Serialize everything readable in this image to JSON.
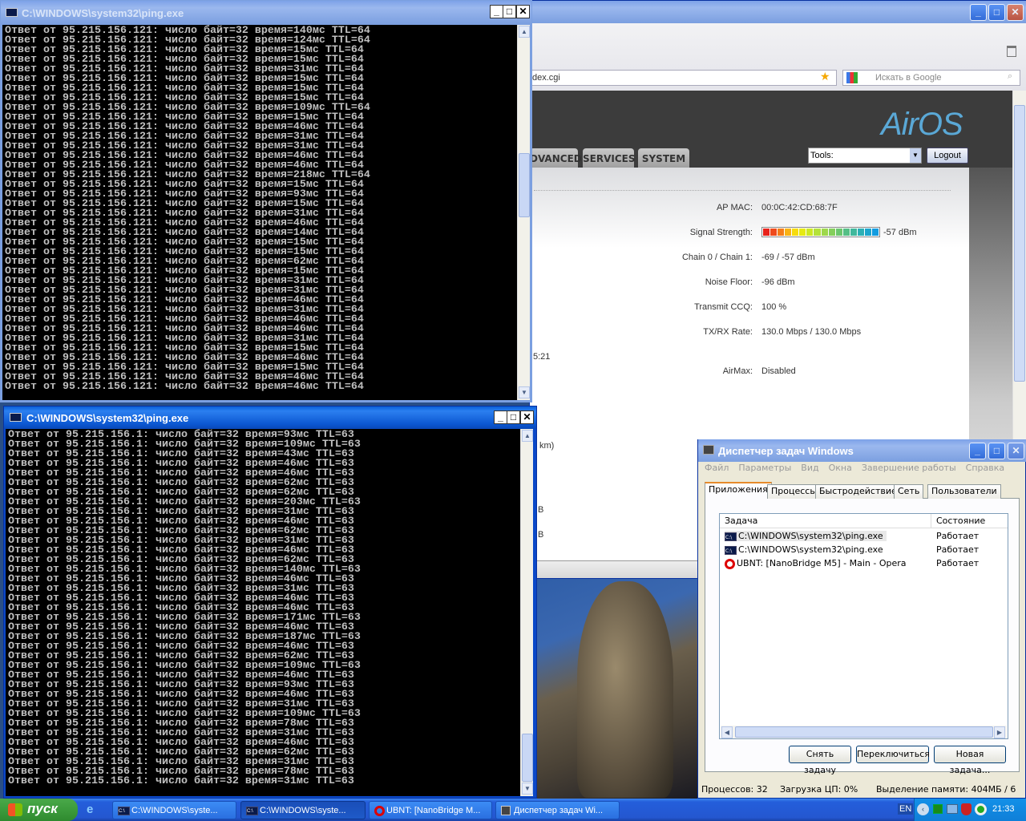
{
  "ping_top": {
    "title": "C:\\WINDOWS\\system32\\ping.exe",
    "lines": [
      "Ответ от 95.215.156.121: число байт=32 время=140мс TTL=64",
      "Ответ от 95.215.156.121: число байт=32 время=124мс TTL=64",
      "Ответ от 95.215.156.121: число байт=32 время=15мс TTL=64",
      "Ответ от 95.215.156.121: число байт=32 время=15мс TTL=64",
      "Ответ от 95.215.156.121: число байт=32 время=31мс TTL=64",
      "Ответ от 95.215.156.121: число байт=32 время=15мс TTL=64",
      "Ответ от 95.215.156.121: число байт=32 время=15мс TTL=64",
      "Ответ от 95.215.156.121: число байт=32 время=15мс TTL=64",
      "Ответ от 95.215.156.121: число байт=32 время=109мс TTL=64",
      "Ответ от 95.215.156.121: число байт=32 время=15мс TTL=64",
      "Ответ от 95.215.156.121: число байт=32 время=46мс TTL=64",
      "Ответ от 95.215.156.121: число байт=32 время=31мс TTL=64",
      "Ответ от 95.215.156.121: число байт=32 время=31мс TTL=64",
      "Ответ от 95.215.156.121: число байт=32 время=46мс TTL=64",
      "Ответ от 95.215.156.121: число байт=32 время=46мс TTL=64",
      "Ответ от 95.215.156.121: число байт=32 время=218мс TTL=64",
      "Ответ от 95.215.156.121: число байт=32 время=15мс TTL=64",
      "Ответ от 95.215.156.121: число байт=32 время=93мс TTL=64",
      "Ответ от 95.215.156.121: число байт=32 время=15мс TTL=64",
      "Ответ от 95.215.156.121: число байт=32 время=31мс TTL=64",
      "Ответ от 95.215.156.121: число байт=32 время=46мс TTL=64",
      "Ответ от 95.215.156.121: число байт=32 время=14мс TTL=64",
      "Ответ от 95.215.156.121: число байт=32 время=15мс TTL=64",
      "Ответ от 95.215.156.121: число байт=32 время=15мс TTL=64",
      "Ответ от 95.215.156.121: число байт=32 время=62мс TTL=64",
      "Ответ от 95.215.156.121: число байт=32 время=15мс TTL=64",
      "Ответ от 95.215.156.121: число байт=32 время=31мс TTL=64",
      "Ответ от 95.215.156.121: число байт=32 время=31мс TTL=64",
      "Ответ от 95.215.156.121: число байт=32 время=46мс TTL=64",
      "Ответ от 95.215.156.121: число байт=32 время=31мс TTL=64",
      "Ответ от 95.215.156.121: число байт=32 время=46мс TTL=64",
      "Ответ от 95.215.156.121: число байт=32 время=46мс TTL=64",
      "Ответ от 95.215.156.121: число байт=32 время=31мс TTL=64",
      "Ответ от 95.215.156.121: число байт=32 время=15мс TTL=64",
      "Ответ от 95.215.156.121: число байт=32 время=46мс TTL=64",
      "Ответ от 95.215.156.121: число байт=32 время=15мс TTL=64",
      "Ответ от 95.215.156.121: число байт=32 время=46мс TTL=64",
      "Ответ от 95.215.156.121: число байт=32 время=46мс TTL=64"
    ]
  },
  "ping_bottom": {
    "title": "C:\\WINDOWS\\system32\\ping.exe",
    "lines": [
      "Ответ от 95.215.156.1: число байт=32 время=93мс TTL=63",
      "Ответ от 95.215.156.1: число байт=32 время=109мс TTL=63",
      "Ответ от 95.215.156.1: число байт=32 время=43мс TTL=63",
      "Ответ от 95.215.156.1: число байт=32 время=46мс TTL=63",
      "Ответ от 95.215.156.1: число байт=32 время=46мс TTL=63",
      "Ответ от 95.215.156.1: число байт=32 время=62мс TTL=63",
      "Ответ от 95.215.156.1: число байт=32 время=62мс TTL=63",
      "Ответ от 95.215.156.1: число байт=32 время=203мс TTL=63",
      "Ответ от 95.215.156.1: число байт=32 время=31мс TTL=63",
      "Ответ от 95.215.156.1: число байт=32 время=46мс TTL=63",
      "Ответ от 95.215.156.1: число байт=32 время=62мс TTL=63",
      "Ответ от 95.215.156.1: число байт=32 время=31мс TTL=63",
      "Ответ от 95.215.156.1: число байт=32 время=46мс TTL=63",
      "Ответ от 95.215.156.1: число байт=32 время=62мс TTL=63",
      "Ответ от 95.215.156.1: число байт=32 время=140мс TTL=63",
      "Ответ от 95.215.156.1: число байт=32 время=46мс TTL=63",
      "Ответ от 95.215.156.1: число байт=32 время=31мс TTL=63",
      "Ответ от 95.215.156.1: число байт=32 время=46мс TTL=63",
      "Ответ от 95.215.156.1: число байт=32 время=46мс TTL=63",
      "Ответ от 95.215.156.1: число байт=32 время=171мс TTL=63",
      "Ответ от 95.215.156.1: число байт=32 время=46мс TTL=63",
      "Ответ от 95.215.156.1: число байт=32 время=187мс TTL=63",
      "Ответ от 95.215.156.1: число байт=32 время=46мс TTL=63",
      "Ответ от 95.215.156.1: число байт=32 время=62мс TTL=63",
      "Ответ от 95.215.156.1: число байт=32 время=109мс TTL=63",
      "Ответ от 95.215.156.1: число байт=32 время=46мс TTL=63",
      "Ответ от 95.215.156.1: число байт=32 время=93мс TTL=63",
      "Ответ от 95.215.156.1: число байт=32 время=46мс TTL=63",
      "Ответ от 95.215.156.1: число байт=32 время=31мс TTL=63",
      "Ответ от 95.215.156.1: число байт=32 время=109мс TTL=63",
      "Ответ от 95.215.156.1: число байт=32 время=78мс TTL=63",
      "Ответ от 95.215.156.1: число байт=32 время=31мс TTL=63",
      "Ответ от 95.215.156.1: число байт=32 время=46мс TTL=63",
      "Ответ от 95.215.156.1: число байт=32 время=62мс TTL=63",
      "Ответ от 95.215.156.1: число байт=32 время=31мс TTL=63",
      "Ответ от 95.215.156.1: число байт=32 время=78мс TTL=63",
      "Ответ от 95.215.156.1: число байт=32 время=31мс TTL=63"
    ]
  },
  "browser": {
    "address": "dex.cgi",
    "search_placeholder": "Искать в Google",
    "logo": "AirOS",
    "tabs": [
      "DVANCED",
      "SERVICES",
      "SYSTEM"
    ],
    "tools_select": "Tools:",
    "logout": "Logout",
    "partial_left": [
      "5:21",
      "km)",
      "B",
      "B"
    ],
    "fields": [
      {
        "label": "AP MAC:",
        "value": "00:0C:42:CD:68:7F"
      },
      {
        "label": "Signal Strength:",
        "value": "-57 dBm"
      },
      {
        "label": "Chain 0 / Chain 1:",
        "value": "-69 / -57 dBm"
      },
      {
        "label": "Noise Floor:",
        "value": "-96 dBm"
      },
      {
        "label": "Transmit CCQ:",
        "value": "100 %"
      },
      {
        "label": "TX/RX Rate:",
        "value": "130.0 Mbps  / 130.0 Mbps"
      },
      {
        "label": "AirMax:",
        "value": "Disabled"
      }
    ],
    "signal_level_percent": 100,
    "signal_colors": [
      "#e8231b",
      "#ef4a1c",
      "#f57d1a",
      "#f9b214",
      "#f7dc0d",
      "#e6ea12",
      "#cde824",
      "#b4e23a",
      "#9ed84c",
      "#84cf5c",
      "#6cc66f",
      "#55bf86",
      "#40b89c",
      "#2cb0b5",
      "#1ca6cd",
      "#129ce0"
    ]
  },
  "taskmgr": {
    "title": "Диспетчер задач Windows",
    "menu": [
      "Файл",
      "Параметры",
      "Вид",
      "Окна",
      "Завершение работы",
      "Справка"
    ],
    "tabs": [
      "Приложения",
      "Процессы",
      "Быстродействие",
      "Сеть",
      "Пользователи"
    ],
    "columns": [
      "Задача",
      "Состояние"
    ],
    "rows": [
      {
        "task": "C:\\WINDOWS\\system32\\ping.exe",
        "status": "Работает",
        "icon": "cmd-icon"
      },
      {
        "task": "C:\\WINDOWS\\system32\\ping.exe",
        "status": "Работает",
        "icon": "cmd-icon"
      },
      {
        "task": "UBNT: [NanoBridge M5] - Main - Opera",
        "status": "Работает",
        "icon": "opera-icon"
      }
    ],
    "buttons": [
      "Снять задачу",
      "Переключиться",
      "Новая задача..."
    ],
    "status": {
      "processes": "Процессов: 32",
      "cpu": "Загрузка ЦП: 0%",
      "memory": "Выделение памяти: 404МБ / 6"
    }
  },
  "taskbar": {
    "start": "пуск",
    "items": [
      "C:\\WINDOWS\\syste...",
      "C:\\WINDOWS\\syste...",
      "UBNT: [NanoBridge M...",
      "Диспетчер задач Wi..."
    ],
    "lang": "EN",
    "clock": "21:33"
  }
}
